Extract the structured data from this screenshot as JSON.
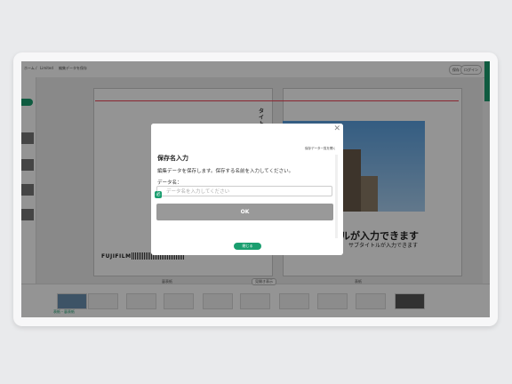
{
  "topbar": {
    "breadcrumb": "ホーム / ",
    "brand": "Limited",
    "save_status": "編集データを保存",
    "preview_label": "保存",
    "signin_label": "ログイン"
  },
  "editor": {
    "cover_vertical_title": "タイトル",
    "cover_big_title": "ールが入力できます",
    "cover_subtitle": "サブタイトルが入力できます",
    "logo": "FUJIFILM",
    "left_page_label": "裏表紙",
    "right_page_label": "表紙",
    "center_button_label": "見開き表示",
    "selected_thumb_label": "表紙・裏表紙"
  },
  "dialog": {
    "history_link": "保存データ一覧を開く",
    "title": "保存名入力",
    "description": "編集データを保存します。保存する名前を入力してください。",
    "field_label": "データ名：",
    "input_placeholder": "データ名を入力してください",
    "input_badge": "必",
    "ok_label": "OK",
    "close_label": "閉じる"
  },
  "colors": {
    "accent": "#1a9e6f",
    "ok_button": "#999999"
  }
}
